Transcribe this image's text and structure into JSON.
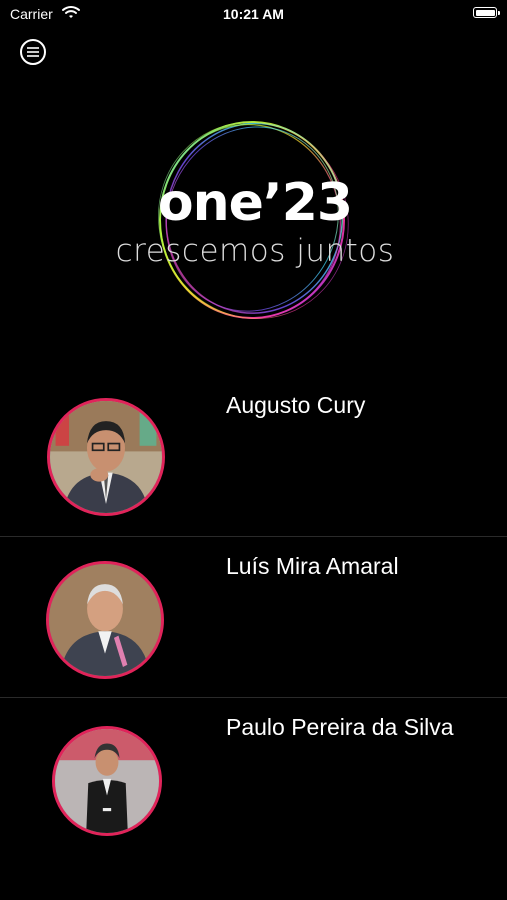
{
  "status_bar": {
    "carrier": "Carrier",
    "time": "10:21 AM"
  },
  "header": {
    "menu_icon": "menu-icon"
  },
  "logo": {
    "title": "one’23",
    "subtitle": "crescemos juntos"
  },
  "speakers": [
    {
      "name": "Augusto Cury"
    },
    {
      "name": "Luís Mira Amaral"
    },
    {
      "name": "Paulo Pereira da Silva"
    }
  ],
  "colors": {
    "background": "#000000",
    "avatar_border": "#e0245a",
    "text": "#ffffff"
  }
}
